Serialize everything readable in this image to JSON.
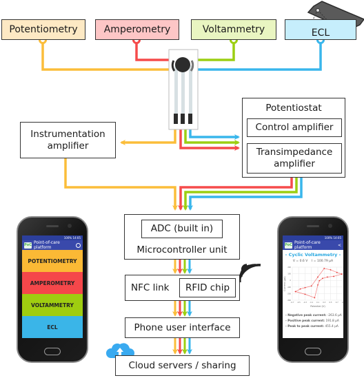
{
  "techniques": [
    {
      "label": "Potentiometry",
      "fill": "#fde9c4",
      "wire": "#fbbd3a"
    },
    {
      "label": "Amperometry",
      "fill": "#fdc6c6",
      "wire": "#f54b4b"
    },
    {
      "label": "Voltammetry",
      "fill": "#e9f5c1",
      "wire": "#9ccf12"
    },
    {
      "label": "ECL",
      "fill": "#c6eefc",
      "wire": "#39b6ec"
    }
  ],
  "blocks": {
    "instrumentation_amplifier": "Instrumentation amplifier",
    "potentiostat": {
      "title": "Potentiostat",
      "control_amplifier": "Control amplifier",
      "transimpedance_amplifier": "Transimpedance amplifier"
    },
    "mcu": {
      "adc": "ADC (built in)",
      "label": "Microcontroller unit"
    },
    "nfc": {
      "label": "NFC link",
      "rfid": "RFID chip"
    },
    "phone_ui": "Phone user interface",
    "cloud": "Cloud servers / sharing"
  },
  "icons": {
    "sensor": "screen-printed-electrode-icon",
    "nfc": "wireless-signal-icon",
    "cloud": "cloud-upload-icon",
    "ecl_phone": "smartphone-camera-icon"
  },
  "left_phone": {
    "app_title": "Point-of-care platform",
    "logo": "PoC",
    "status": "100% 14:05",
    "menu": [
      {
        "label": "POTENTIOMETRY",
        "color": "#fbb935"
      },
      {
        "label": "AMPEROMETRY",
        "color": "#f5474a"
      },
      {
        "label": "VOLTAMMETRY",
        "color": "#9fcd10"
      },
      {
        "label": "ECL",
        "color": "#3ab5e8"
      }
    ]
  },
  "right_phone": {
    "app_title": "Point-of-care platform",
    "logo": "PoC",
    "status": "100% 14:05",
    "heading": "- Cyclic Voltammetry -",
    "readout_v": "V = 0.6 V",
    "readout_i": "I = 100.79 µA",
    "results": [
      {
        "label": "- Negative peak current:",
        "value": "-263.6 µA"
      },
      {
        "label": "- Positive peak current:",
        "value": "191.8 µA"
      },
      {
        "label": "- Peak to peak current:",
        "value": "455.4 µA"
      }
    ],
    "chart": {
      "xlabel": "Potential (V)",
      "ylabel": "Current (µA)",
      "yticks": [
        "200",
        "100",
        "0",
        "-100",
        "-200",
        "-300"
      ],
      "xticks": [
        "-0.7",
        "-0.5",
        "-0.3",
        "-0.1",
        "0.1",
        "0.3",
        "0.5",
        "0.7",
        "0.9"
      ],
      "forward": [
        [
          -0.6,
          -170
        ],
        [
          -0.45,
          -130
        ],
        [
          -0.3,
          -110
        ],
        [
          -0.1,
          -85
        ],
        [
          0.1,
          50
        ],
        [
          0.3,
          180
        ],
        [
          0.5,
          160
        ],
        [
          0.7,
          120
        ],
        [
          0.85,
          95
        ]
      ],
      "reverse": [
        [
          0.85,
          95
        ],
        [
          0.6,
          60
        ],
        [
          0.4,
          50
        ],
        [
          0.25,
          30
        ],
        [
          0.15,
          -5
        ],
        [
          0.1,
          -70
        ],
        [
          0.0,
          -263
        ],
        [
          -0.3,
          -210
        ],
        [
          -0.6,
          -170
        ]
      ]
    }
  }
}
